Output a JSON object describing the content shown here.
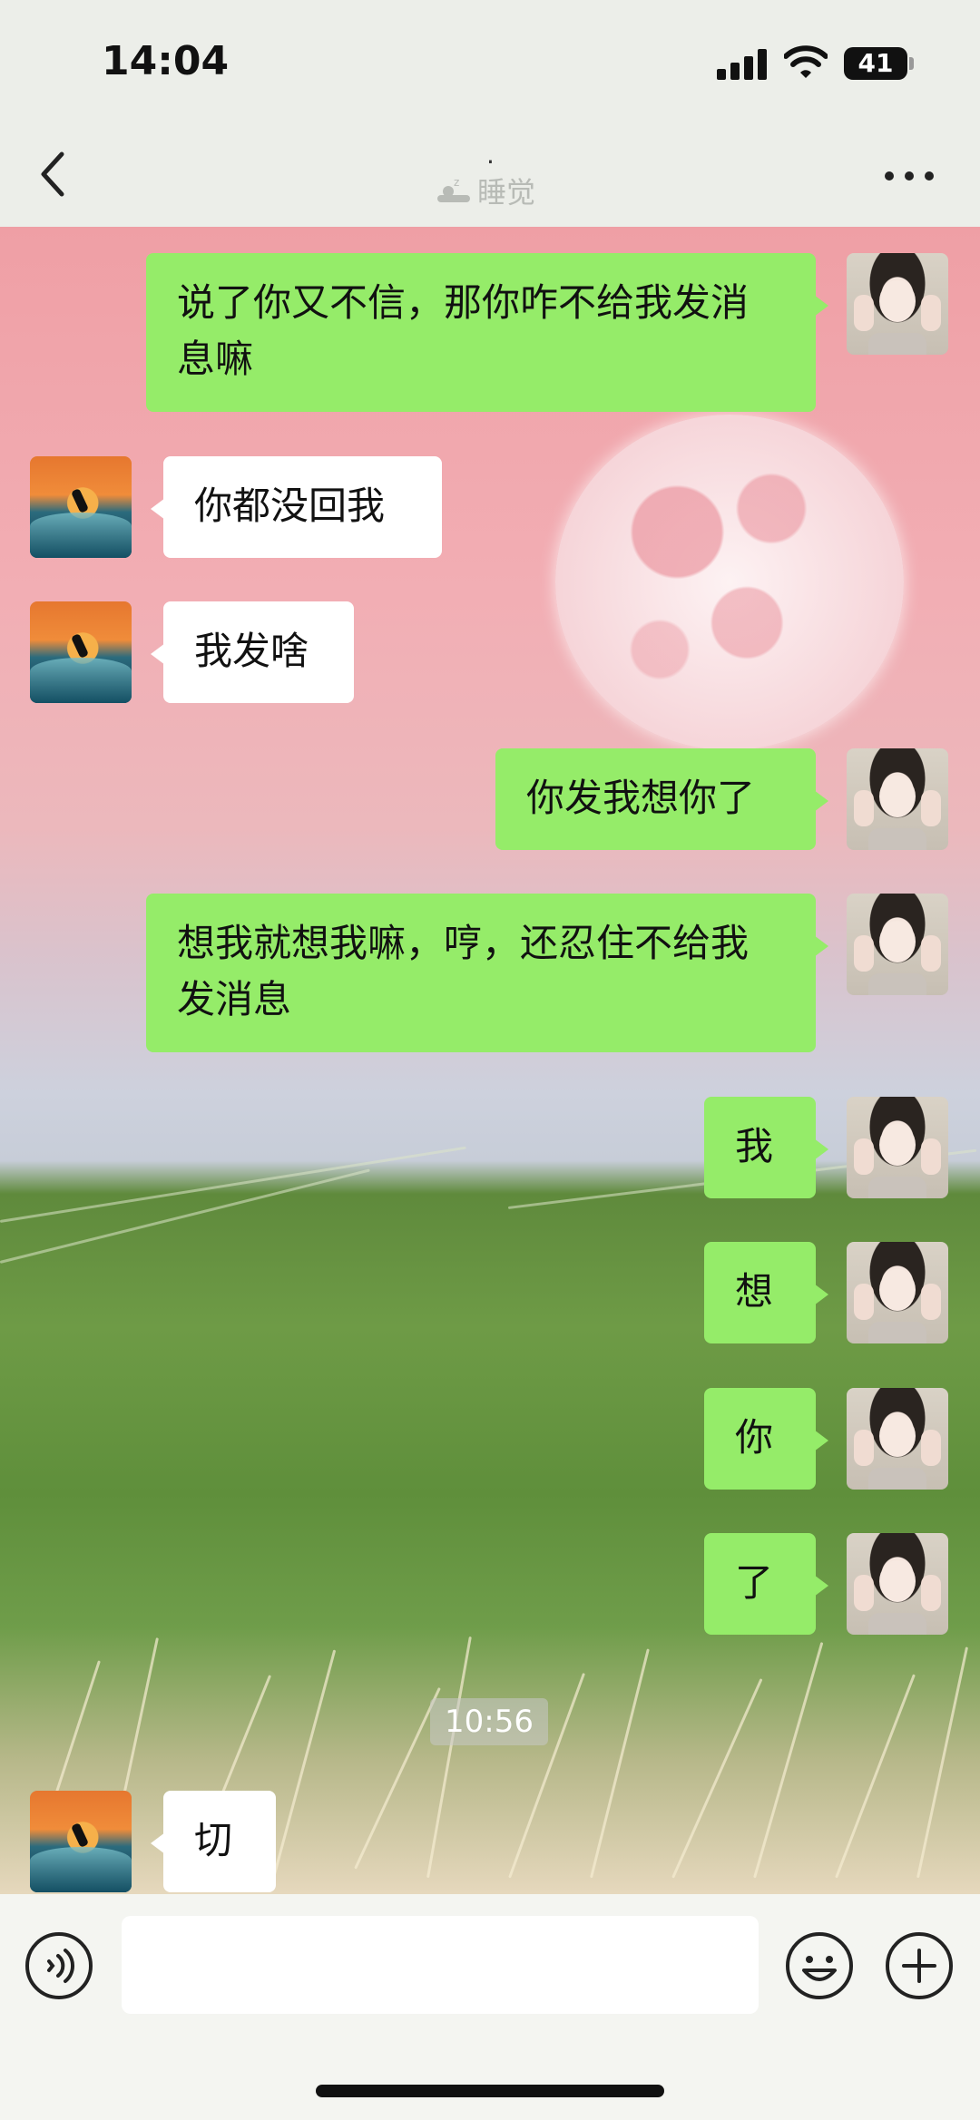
{
  "status_bar": {
    "time": "14:04",
    "battery": "41"
  },
  "header": {
    "title": "·",
    "status_text": "睡觉"
  },
  "messages": [
    {
      "sender": "me",
      "text": "说了你又不信，那你咋不给我发消息嘛"
    },
    {
      "sender": "them",
      "text": "你都没回我"
    },
    {
      "sender": "them",
      "text": "我发啥"
    },
    {
      "sender": "me",
      "text": "你发我想你了"
    },
    {
      "sender": "me",
      "text": "想我就想我嘛，哼，还忍住不给我发消息"
    },
    {
      "sender": "me",
      "text": "我"
    },
    {
      "sender": "me",
      "text": "想"
    },
    {
      "sender": "me",
      "text": "你"
    },
    {
      "sender": "me",
      "text": "了"
    },
    {
      "sender": "them",
      "text": "切"
    }
  ],
  "timestamp": "10:56",
  "input": {
    "value": "",
    "placeholder": ""
  },
  "colors": {
    "my_bubble": "#95ec69",
    "their_bubble": "#ffffff",
    "nav_bg": "#eceee9"
  },
  "icons": {
    "back": "chevron-left-icon",
    "more": "more-dots-icon",
    "voice": "voice-icon",
    "emoji": "emoji-icon",
    "plus": "plus-icon",
    "status": "sleep-icon"
  }
}
